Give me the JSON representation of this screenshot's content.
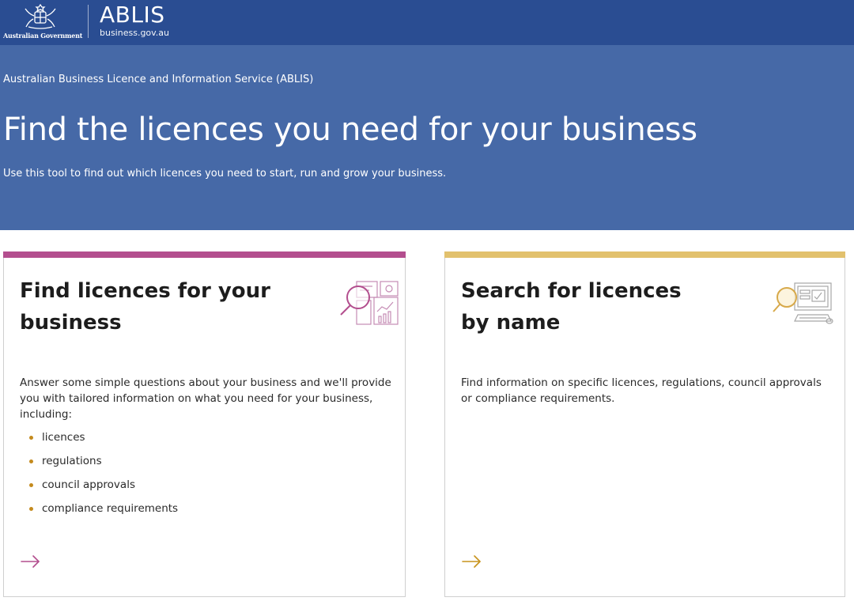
{
  "header": {
    "government_label": "Australian Government",
    "brand_name": "ABLIS",
    "brand_domain": "business.gov.au",
    "color": "#2a4d92"
  },
  "hero": {
    "service_name": "Australian Business Licence and Information Service (ABLIS)",
    "title": "Find the licences you need for your business",
    "intro": "Use this tool to find out which licences you need to start, run and grow your business.",
    "color": "#4669a7"
  },
  "cards": [
    {
      "title": "Find licences for your business",
      "description": "Answer some simple questions about your business and we'll provide you with tailored information on what you need for your business, including:",
      "bullets": [
        "licences",
        "regulations",
        "council approvals",
        "compliance requirements"
      ],
      "icon": "magnifier-charts-icon",
      "action_icon": "arrow-right-icon",
      "accent_color": "#b34e8e"
    },
    {
      "title": "Search for licences by name",
      "description": "Find information on specific licences, regulations, council approvals or compliance requirements.",
      "icon": "magnifier-computer-icon",
      "action_icon": "arrow-right-icon",
      "accent_color": "#e2c16d"
    }
  ]
}
